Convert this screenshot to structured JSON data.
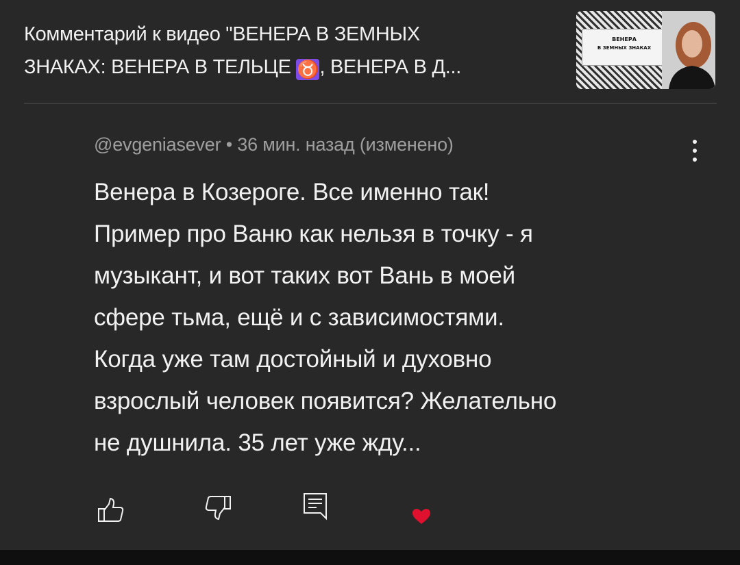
{
  "header": {
    "title_line1": "Комментарий к видео \"ВЕНЕРА В ЗЕМНЫХ",
    "title_line2_before": "ЗНАКАХ: ВЕНЕРА В ТЕЛЬЦЕ ",
    "zodiac_symbol": "♉",
    "title_line2_after": ", ВЕНЕРА В Д...",
    "thumbnail": {
      "line1": "ВЕНЕРА",
      "line2": "В ЗЕМНЫХ ЗНАКАХ"
    }
  },
  "comment": {
    "author": "@evgeniasever",
    "separator": " • ",
    "time": "36 мин. назад (изменено)",
    "lines": [
      "Венера в Козероге. Все именно так!",
      "Пример про Ваню как нельзя в точку - я",
      "музыкант, и вот таких вот Вань в моей",
      "сфере тьма, ещё и с зависимостями.",
      "Когда уже там достойный и духовно",
      "взрослый человек появится? Желательно",
      "не душнила. 35 лет уже жду..."
    ]
  },
  "actions": {
    "like": "thumbs-up-icon",
    "dislike": "thumbs-down-icon",
    "reply": "reply-icon",
    "heart": "heart-icon"
  },
  "colors": {
    "background": "#282828",
    "text": "#f1f1f1",
    "meta": "#9e9e9e",
    "zodiac_badge": "#7d4be5",
    "heart": "#e0102f"
  }
}
